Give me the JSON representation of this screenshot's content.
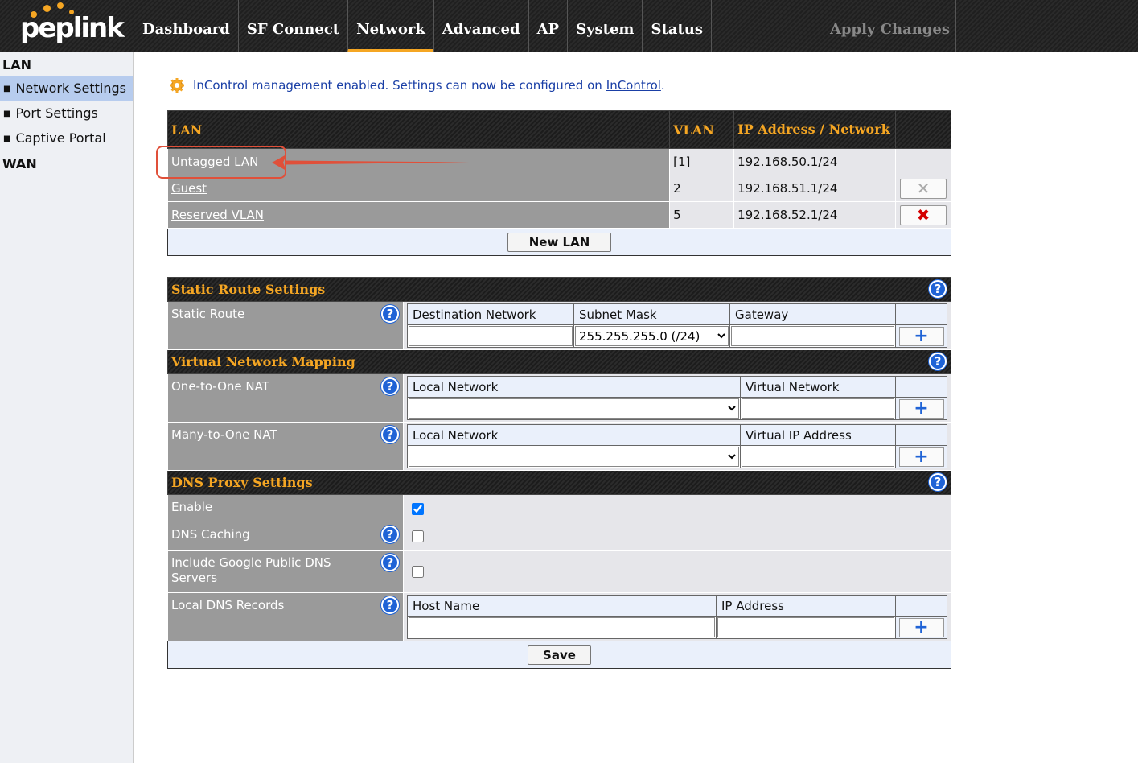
{
  "brand": {
    "logo_text": "peplink"
  },
  "nav": {
    "tabs": [
      {
        "label": "Dashboard"
      },
      {
        "label": "SF Connect"
      },
      {
        "label": "Network"
      },
      {
        "label": "Advanced"
      },
      {
        "label": "AP"
      },
      {
        "label": "System"
      },
      {
        "label": "Status"
      }
    ],
    "active_tab": "Network",
    "apply_changes": "Apply Changes"
  },
  "sidebar": {
    "sections": [
      {
        "heading": "LAN",
        "items": [
          {
            "label": "Network Settings",
            "active": true
          },
          {
            "label": "Port Settings",
            "active": false
          },
          {
            "label": "Captive Portal",
            "active": false
          }
        ]
      },
      {
        "heading": "WAN",
        "items": []
      }
    ]
  },
  "notice": {
    "text": "InControl management enabled. Settings can now be configured on",
    "link": "InControl",
    "trailing": "."
  },
  "lan_table": {
    "headers": {
      "lan": "LAN",
      "vlan": "VLAN",
      "ip": "IP Address / Network"
    },
    "rows": [
      {
        "name": "Untagged LAN",
        "vlan": "[1]",
        "ip": "192.168.50.1/24",
        "delete": "none"
      },
      {
        "name": "Guest",
        "vlan": "2",
        "ip": "192.168.51.1/24",
        "delete": "disabled"
      },
      {
        "name": "Reserved VLAN",
        "vlan": "5",
        "ip": "192.168.52.1/24",
        "delete": "enabled"
      }
    ],
    "new_button": "New LAN"
  },
  "static_route": {
    "title": "Static Route Settings",
    "label": "Static Route",
    "columns": {
      "dest": "Destination Network",
      "mask": "Subnet Mask",
      "gateway": "Gateway"
    },
    "mask_value": "255.255.255.0 (/24)"
  },
  "vnm": {
    "title": "Virtual Network Mapping",
    "one_to_one": {
      "label": "One-to-One NAT",
      "col1": "Local Network",
      "col2": "Virtual Network"
    },
    "many_to_one": {
      "label": "Many-to-One NAT",
      "col1": "Local Network",
      "col2": "Virtual IP Address"
    }
  },
  "dns": {
    "title": "DNS Proxy Settings",
    "enable": {
      "label": "Enable",
      "checked": true
    },
    "caching": {
      "label": "DNS Caching",
      "checked": false
    },
    "google": {
      "label": "Include Google Public DNS Servers",
      "checked": false
    },
    "records": {
      "label": "Local DNS Records",
      "col1": "Host Name",
      "col2": "IP Address"
    }
  },
  "save_button": "Save",
  "icons": {
    "help": "help-icon",
    "add": "plus-icon",
    "delete": "close-icon",
    "notice": "gear-icon",
    "dropdown": "chevron-down-icon"
  },
  "colors": {
    "accent": "#f5a623",
    "link": "#1a3fa6",
    "delete_active": "#d40000",
    "help": "#1f63d6",
    "annotation": "#e0503a"
  }
}
